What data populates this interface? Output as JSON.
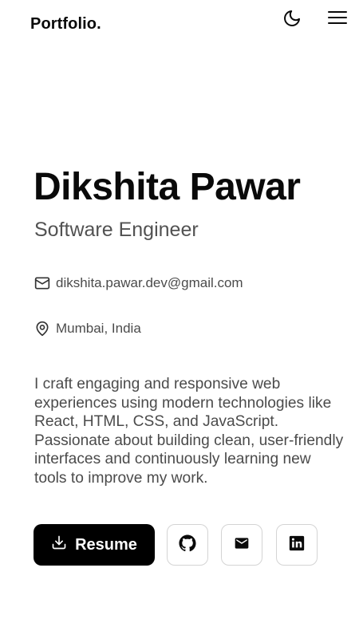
{
  "header": {
    "logo": "Portfolio.",
    "theme_icon": "moon-icon",
    "menu_icon": "hamburger-menu-icon"
  },
  "hero": {
    "name": "Dikshita Pawar",
    "role": "Software Engineer",
    "email": "dikshita.pawar.dev@gmail.com",
    "email_icon": "mail-outline-icon",
    "location": "Mumbai, India",
    "location_icon": "map-pin-icon",
    "bio": "I craft engaging and responsive web experiences using modern technologies like React, HTML, CSS, and JavaScript. Passionate about building clean, user-friendly interfaces and continuously learning new tools to improve my work."
  },
  "actions": {
    "resume_label": "Resume",
    "resume_icon": "download-icon",
    "social": [
      {
        "icon": "github-icon"
      },
      {
        "icon": "mail-icon"
      },
      {
        "icon": "linkedin-icon"
      }
    ]
  },
  "colors": {
    "text_primary": "#0a0a0a",
    "text_secondary": "#525252",
    "button_bg": "#000000",
    "button_text": "#ffffff",
    "icon_button_border": "#d4d4d4"
  }
}
